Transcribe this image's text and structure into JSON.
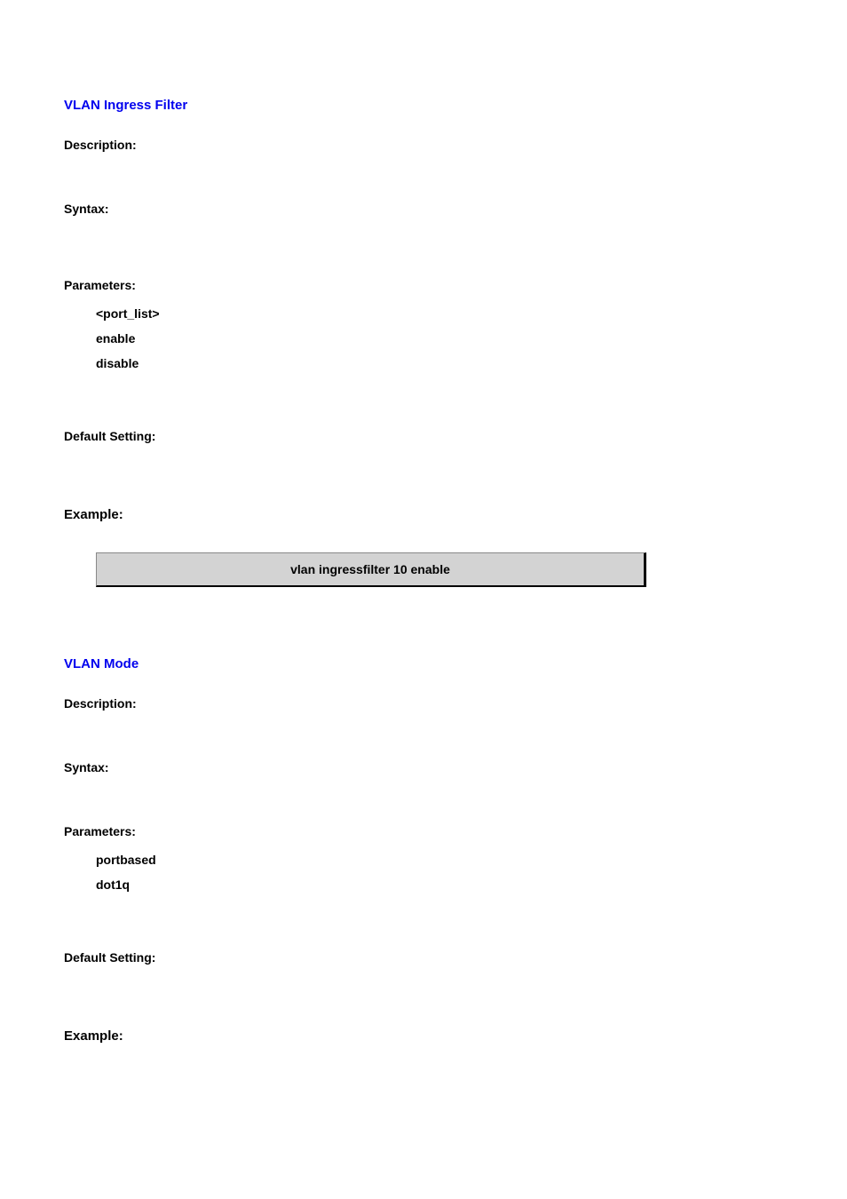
{
  "section1": {
    "title": "VLAN Ingress Filter",
    "labels": {
      "description": "Description:",
      "syntax": "Syntax:",
      "parameters": "Parameters:",
      "default_setting": "Default Setting:",
      "example": "Example:"
    },
    "parameters": [
      "<port_list>",
      "enable",
      "disable"
    ],
    "example_code": "vlan ingressfilter 10 enable"
  },
  "section2": {
    "title": "VLAN Mode",
    "labels": {
      "description": "Description:",
      "syntax": "Syntax:",
      "parameters": "Parameters:",
      "default_setting": "Default Setting:",
      "example": "Example:"
    },
    "parameters": [
      "portbased",
      "dot1q"
    ]
  }
}
